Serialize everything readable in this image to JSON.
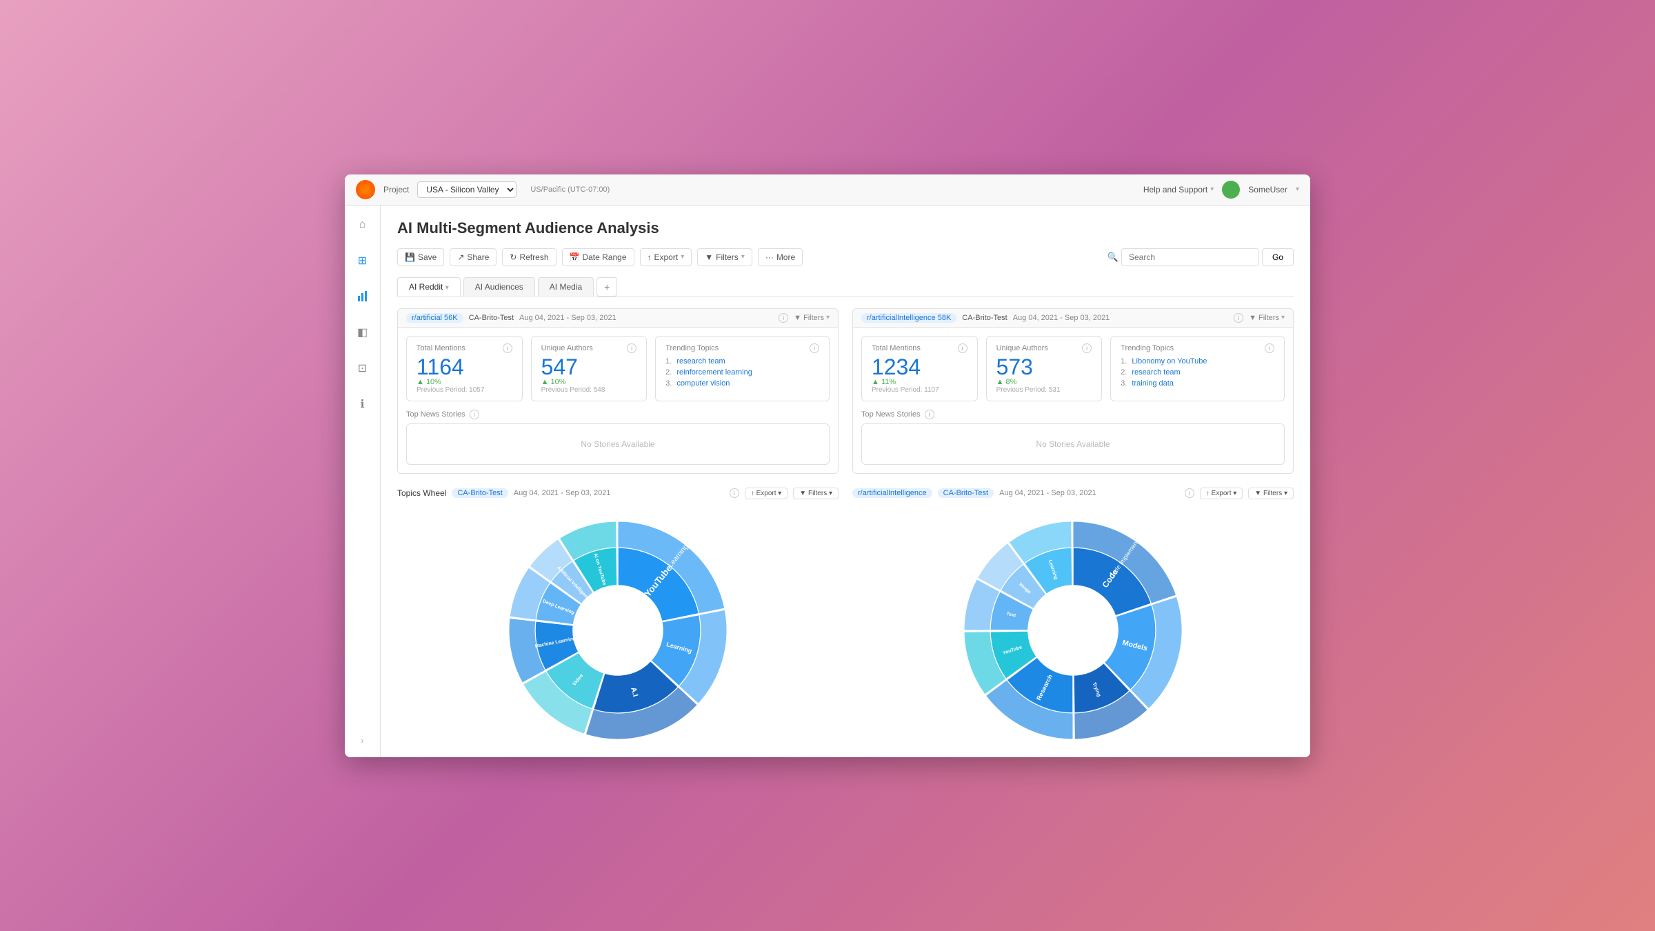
{
  "window": {
    "title": "AI Multi-Segment Audience Analysis"
  },
  "topbar": {
    "project_label": "Project",
    "project_value": "USA - Silicon Valley",
    "timezone": "US/Pacific (UTC-07:00)",
    "help_label": "Help and Support",
    "user_name": "SomeUser"
  },
  "toolbar": {
    "save_label": "Save",
    "share_label": "Share",
    "refresh_label": "Refresh",
    "date_range_label": "Date Range",
    "export_label": "Export",
    "filters_label": "Filters",
    "more_label": "More",
    "search_placeholder": "Search",
    "go_label": "Go"
  },
  "tabs": [
    {
      "id": "reddit",
      "label": "AI Reddit",
      "active": true
    },
    {
      "id": "audiences",
      "label": "AI Audiences",
      "active": false
    },
    {
      "id": "media",
      "label": "AI Media",
      "active": false
    }
  ],
  "sidebar": {
    "items": [
      {
        "id": "home",
        "icon": "⌂",
        "label": "Home"
      },
      {
        "id": "grid",
        "icon": "⊞",
        "label": "Grid"
      },
      {
        "id": "chart",
        "icon": "⬆",
        "label": "Chart"
      },
      {
        "id": "layers",
        "icon": "◧",
        "label": "Layers"
      },
      {
        "id": "metrics",
        "icon": "⊡",
        "label": "Metrics"
      },
      {
        "id": "info",
        "icon": "ℹ",
        "label": "Info"
      }
    ],
    "collapse_label": "›"
  },
  "panel_left": {
    "segment": "r/artificial 56K",
    "audience": "CA-Brito-Test",
    "date_range": "Aug 04, 2021 - Sep 03, 2021",
    "total_mentions": {
      "label": "Total Mentions",
      "value": "1164",
      "change": "▲ 10%",
      "prev_label": "Previous Period:",
      "prev_value": "1057"
    },
    "unique_authors": {
      "label": "Unique Authors",
      "value": "547",
      "change": "▲ 10%",
      "prev_label": "Previous Period:",
      "prev_value": "548"
    },
    "trending_topics": {
      "label": "Trending Topics",
      "items": [
        {
          "num": "1.",
          "text": "research team"
        },
        {
          "num": "2.",
          "text": "reinforcement learning"
        },
        {
          "num": "3.",
          "text": "computer vision"
        }
      ]
    },
    "top_news": {
      "label": "Top News Stories",
      "no_stories": "No Stories Available"
    }
  },
  "panel_right": {
    "segment": "r/artificialIntelligence 58K",
    "audience": "CA-Brito-Test",
    "date_range": "Aug 04, 2021 - Sep 03, 2021",
    "total_mentions": {
      "label": "Total Mentions",
      "value": "1234",
      "change": "▲ 11%",
      "prev_label": "Previous Period:",
      "prev_value": "1107"
    },
    "unique_authors": {
      "label": "Unique Authors",
      "value": "573",
      "change": "▲ 8%",
      "prev_label": "Previous Period:",
      "prev_value": "531"
    },
    "trending_topics": {
      "label": "Trending Topics",
      "items": [
        {
          "num": "1.",
          "text": "Libonomy on YouTube"
        },
        {
          "num": "2.",
          "text": "research team"
        },
        {
          "num": "3.",
          "text": "training data"
        }
      ]
    },
    "top_news": {
      "label": "Top News Stories",
      "no_stories": "No Stories Available"
    }
  },
  "topics_wheel_left": {
    "label": "Topics Wheel",
    "segment": "CA-Brito-Test",
    "date_range": "Aug 04, 2021 - Sep 03, 2021",
    "segments": [
      {
        "label": "YouTube",
        "size": 0.22,
        "color": "#2196F3",
        "sub": [
          "Learning",
          "AI on YouTube"
        ]
      },
      {
        "label": "Learning",
        "size": 0.15,
        "color": "#42A5F5",
        "sub": []
      },
      {
        "label": "A.I",
        "size": 0.18,
        "color": "#1565C0",
        "sub": []
      },
      {
        "label": "Video",
        "size": 0.12,
        "color": "#4DD0E1",
        "sub": []
      },
      {
        "label": "Machine Learning",
        "size": 0.1,
        "color": "#1E88E5",
        "sub": []
      },
      {
        "label": "Deep Learning",
        "size": 0.08,
        "color": "#64B5F6",
        "sub": []
      },
      {
        "label": "Artificial Intelligence",
        "size": 0.06,
        "color": "#90CAF9",
        "sub": []
      },
      {
        "label": "AI on YouTube",
        "size": 0.09,
        "color": "#26C6DA",
        "sub": []
      }
    ]
  },
  "topics_wheel_right": {
    "label": "r/artificialIntelligence",
    "segment": "CA-Brito-Test",
    "date_range": "Aug 04, 2021 - Sep 03, 2021",
    "segments": [
      {
        "label": "Code",
        "size": 0.2,
        "color": "#1976D2",
        "sub": [
          "Code Implementations"
        ]
      },
      {
        "label": "Models",
        "size": 0.18,
        "color": "#42A5F5",
        "sub": []
      },
      {
        "label": "Trying",
        "size": 0.12,
        "color": "#1565C0",
        "sub": []
      },
      {
        "label": "Research",
        "size": 0.15,
        "color": "#1E88E5",
        "sub": []
      },
      {
        "label": "YouTube",
        "size": 0.1,
        "color": "#26C6DA",
        "sub": []
      },
      {
        "label": "Text",
        "size": 0.08,
        "color": "#64B5F6",
        "sub": []
      },
      {
        "label": "Image",
        "size": 0.07,
        "color": "#90CAF9",
        "sub": []
      },
      {
        "label": "Learning",
        "size": 0.1,
        "color": "#4FC3F7",
        "sub": []
      }
    ]
  }
}
